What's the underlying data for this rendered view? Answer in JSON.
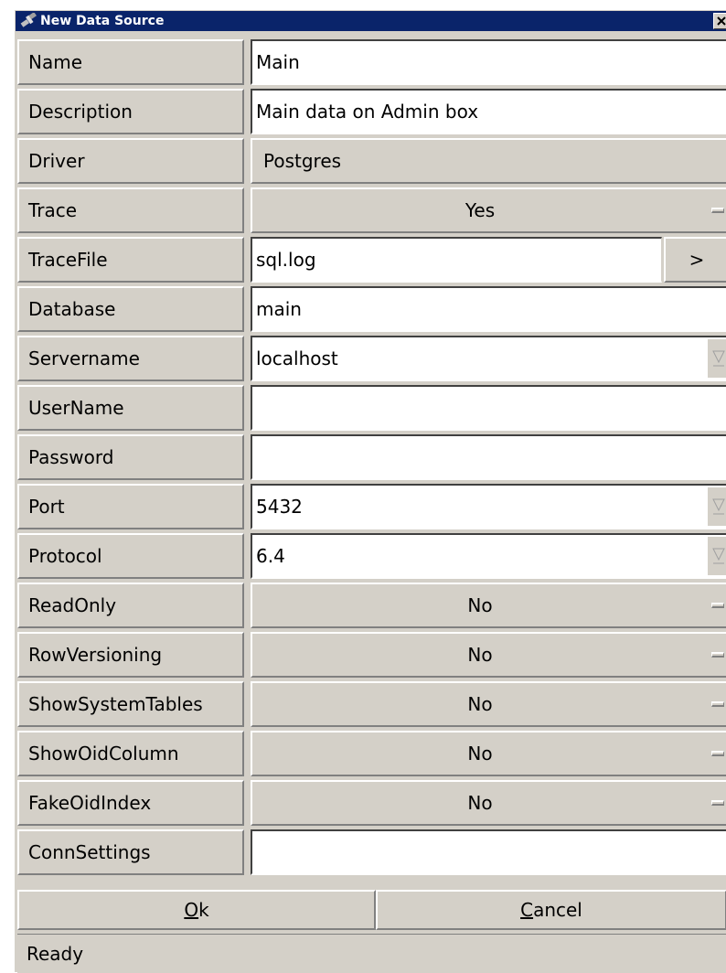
{
  "window": {
    "title": "New Data Source",
    "app_icon": "satellite-icon",
    "close_icon": "close-icon"
  },
  "fields": {
    "name": {
      "label": "Name",
      "value": "Main"
    },
    "description": {
      "label": "Description",
      "value": "Main data on Admin box"
    },
    "driver": {
      "label": "Driver",
      "value": "Postgres"
    },
    "trace": {
      "label": "Trace",
      "value": "Yes"
    },
    "tracefile": {
      "label": "TraceFile",
      "value": "sql.log",
      "browse_label": ">"
    },
    "database": {
      "label": "Database",
      "value": "main"
    },
    "servername": {
      "label": "Servername",
      "value": "localhost"
    },
    "username": {
      "label": "UserName",
      "value": ""
    },
    "password": {
      "label": "Password",
      "value": ""
    },
    "port": {
      "label": "Port",
      "value": "5432"
    },
    "protocol": {
      "label": "Protocol",
      "value": "6.4"
    },
    "readonly": {
      "label": "ReadOnly",
      "value": "No"
    },
    "rowversioning": {
      "label": "RowVersioning",
      "value": "No"
    },
    "showsystemtables": {
      "label": "ShowSystemTables",
      "value": "No"
    },
    "showoidcolumn": {
      "label": "ShowOidColumn",
      "value": "No"
    },
    "fakeoidindex": {
      "label": "FakeOidIndex",
      "value": "No"
    },
    "connsettings": {
      "label": "ConnSettings",
      "value": ""
    }
  },
  "buttons": {
    "ok": {
      "mnemonic": "O",
      "rest": "k"
    },
    "cancel": {
      "mnemonic": "C",
      "rest": "ancel"
    }
  },
  "status": "Ready",
  "colors": {
    "titlebar": "#0a246a",
    "face": "#d4d0c8",
    "field": "#ffffff"
  }
}
